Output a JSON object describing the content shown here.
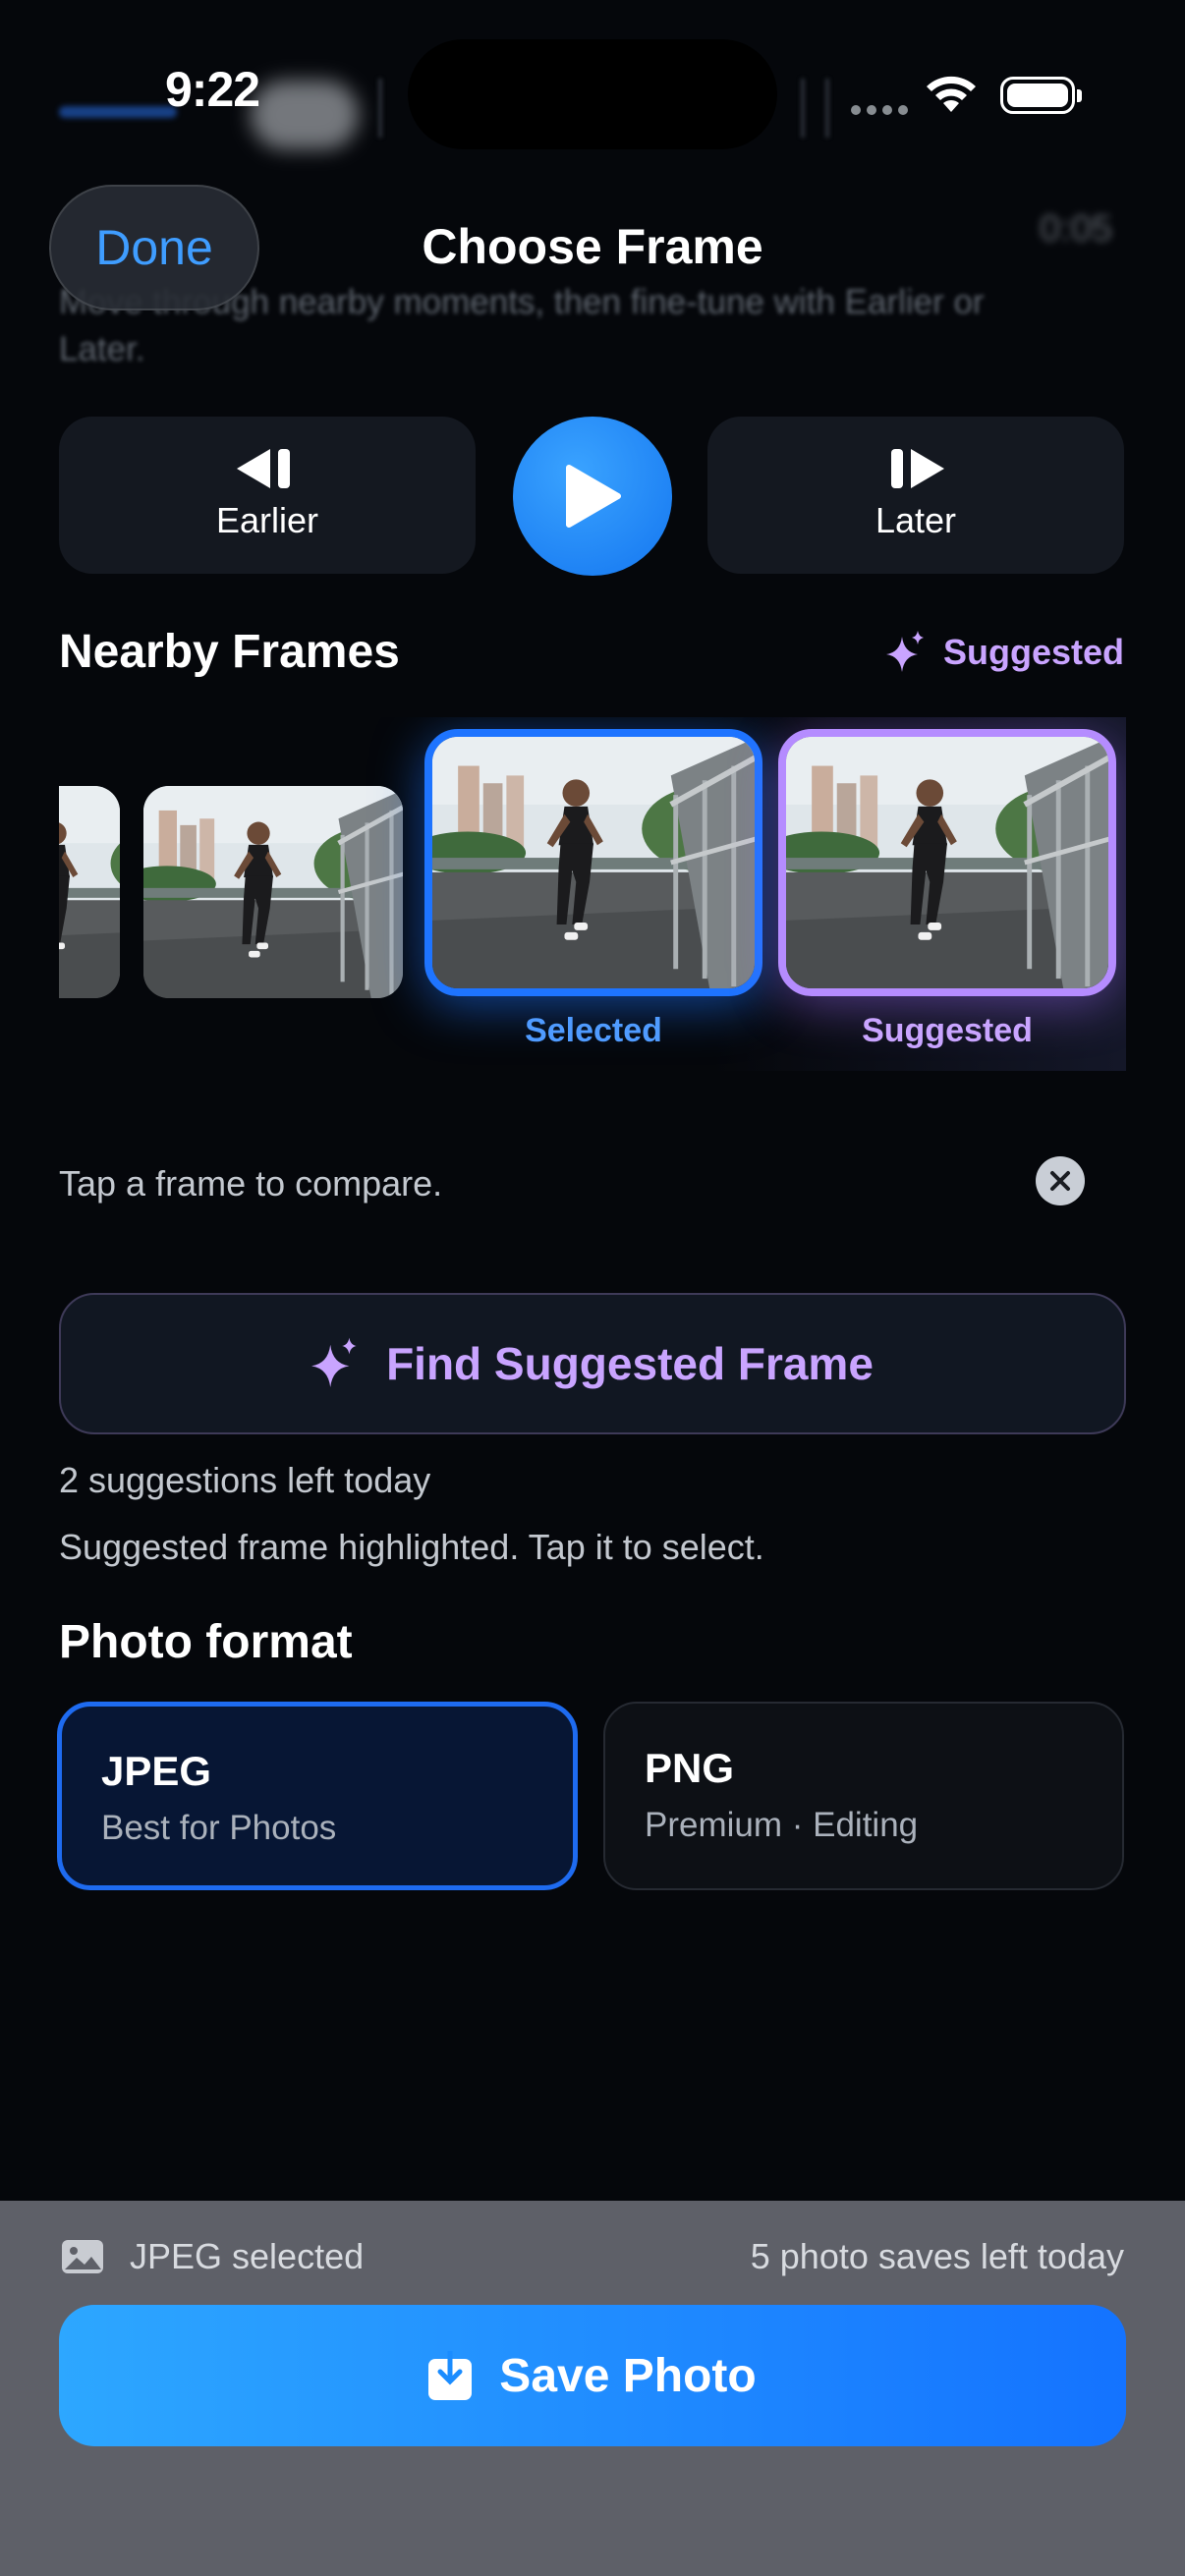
{
  "status_bar": {
    "time": "9:22"
  },
  "header": {
    "done_label": "Done",
    "title": "Choose Frame",
    "blurred_time": "0:05",
    "blurred_hint": "Move through nearby moments, then fine-tune with Earlier or Later."
  },
  "transport": {
    "earlier_label": "Earlier",
    "later_label": "Later"
  },
  "nearby": {
    "title": "Nearby Frames",
    "suggested_tag": "Suggested",
    "selected_label": "Selected",
    "suggested_label": "Suggested"
  },
  "hint": "Tap a frame to compare.",
  "find_button": "Find Suggested Frame",
  "suggestions_left": "2 suggestions left today",
  "suggestion_status": "Suggested frame highlighted. Tap it to select.",
  "format": {
    "title": "Photo format",
    "options": [
      {
        "name": "JPEG",
        "desc": "Best for Photos",
        "selected": true
      },
      {
        "name": "PNG",
        "desc": "Premium · Editing",
        "selected": false
      }
    ]
  },
  "bottom": {
    "selected_text": "JPEG selected",
    "saves_left": "5 photo saves left today",
    "save_label": "Save Photo"
  },
  "colors": {
    "accent": "#1e74ff",
    "suggest": "#b58cff"
  }
}
